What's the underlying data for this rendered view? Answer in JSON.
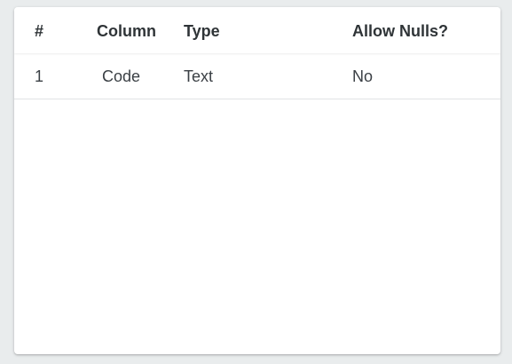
{
  "table": {
    "columns": [
      "#",
      "Column",
      "Type",
      "Allow Nulls?"
    ],
    "rows": [
      {
        "num": "1",
        "column": "Code",
        "type": "Text",
        "allow_nulls": "No"
      }
    ]
  }
}
